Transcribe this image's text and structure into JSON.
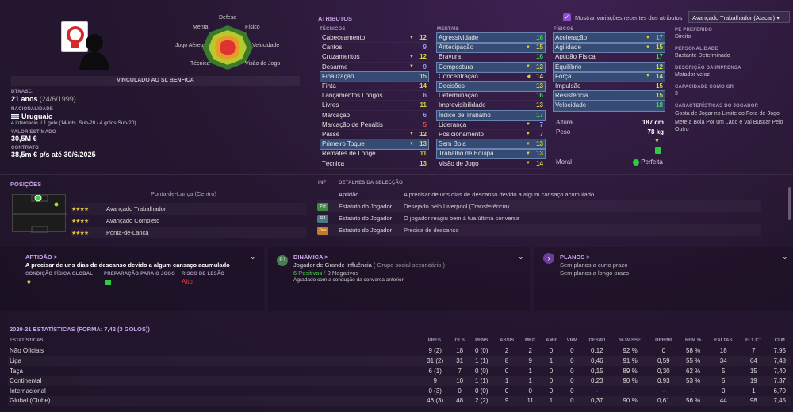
{
  "header": {
    "contract_banner": "VINCULADO AO SL BENFICA"
  },
  "position_radar": {
    "top": "Defesa",
    "top_right": "Físico",
    "right": "Velocidade",
    "bottom_right": "Visão de Jogo",
    "bottom_left": "Técnica",
    "left": "Jogo Aéreo",
    "top_left": "Mental"
  },
  "player": {
    "dob_label": "DTNASC.",
    "age": "21 anos",
    "dob": "(24/6/1999)",
    "nationality_label": "NACIONALIDADE",
    "nationality": "Uruguaio",
    "caps": "4 internacio. / 1 golo (14 ints. Sub-20 / 4 golos Sub-20)",
    "value_label": "VALOR ESTIMADO",
    "value": "30,5M €",
    "contract_label": "CONTRATO",
    "contract": "38,5m € p/s até 30/6/2025"
  },
  "attributes": {
    "title": "ATRIBUTOS",
    "show_changes_label": "Mostrar variações recentes dos atributos",
    "role_select": "Avançado Trabalhador (Atacar)",
    "technical_title": "TÉCNICOS",
    "mental_title": "MENTAIS",
    "physical_title": "FÍSICOS",
    "technical": [
      {
        "n": "Cabeceamento",
        "v": "12"
      },
      {
        "n": "Cantos",
        "v": "9"
      },
      {
        "n": "Cruzamentos",
        "v": "12"
      },
      {
        "n": "Desarme",
        "v": "9"
      },
      {
        "n": "Finalização",
        "v": "15"
      },
      {
        "n": "Finta",
        "v": "14"
      },
      {
        "n": "Lançamentos Longos",
        "v": "6"
      },
      {
        "n": "Livres",
        "v": "11"
      },
      {
        "n": "Marcação",
        "v": "6"
      },
      {
        "n": "Marcação de Penáltis",
        "v": "5"
      },
      {
        "n": "Passe",
        "v": "12"
      },
      {
        "n": "Primeiro Toque",
        "v": "13"
      },
      {
        "n": "Remates de Longe",
        "v": "11"
      },
      {
        "n": "Técnica",
        "v": "13"
      }
    ],
    "mental": [
      {
        "n": "Agressividade",
        "v": "16"
      },
      {
        "n": "Antecipação",
        "v": "15"
      },
      {
        "n": "Bravura",
        "v": "16"
      },
      {
        "n": "Compostura",
        "v": "13"
      },
      {
        "n": "Concentração",
        "v": "14"
      },
      {
        "n": "Decisões",
        "v": "13"
      },
      {
        "n": "Determinação",
        "v": "16"
      },
      {
        "n": "Imprevisibilidade",
        "v": "13"
      },
      {
        "n": "Índice de Trabalho",
        "v": "17"
      },
      {
        "n": "Liderança",
        "v": "7"
      },
      {
        "n": "Posicionamento",
        "v": "7"
      },
      {
        "n": "Sem Bola",
        "v": "13"
      },
      {
        "n": "Trabalho de Equipa",
        "v": "13"
      },
      {
        "n": "Visão de Jogo",
        "v": "14"
      }
    ],
    "physical": [
      {
        "n": "Aceleração",
        "v": "17"
      },
      {
        "n": "Agilidade",
        "v": "15"
      },
      {
        "n": "Aptidão Física",
        "v": "17"
      },
      {
        "n": "Equilíbrio",
        "v": "12"
      },
      {
        "n": "Força",
        "v": "14"
      },
      {
        "n": "Impulsão",
        "v": "15"
      },
      {
        "n": "Resistência",
        "v": "15"
      },
      {
        "n": "Velocidade",
        "v": "18"
      }
    ],
    "height_label": "Altura",
    "height": "187 cm",
    "weight_label": "Peso",
    "weight": "78 kg",
    "morale_label": "Moral",
    "morale": "Perfeita"
  },
  "right": {
    "foot_label": "PÉ PREFERIDO",
    "foot": "Direito",
    "personality_label": "PERSONALIDADE",
    "personality": "Bastante Determinado",
    "press_label": "DESCRIÇÃO DA IMPRENSA",
    "press": "Matador veloz",
    "gk_label": "CAPACIDADE COMO GR",
    "gk": "3",
    "traits_label": "CARACTERÍSTICAS DO JOGADOR",
    "trait1": "Gosta de Jogar no Limite do Fora-de-Jogo",
    "trait2": "Mete a Bola Por um Lado e Vai Buscar Pelo Outro"
  },
  "positions": {
    "title": "POSIÇÕES",
    "main": "Ponta-de-Lança (Centro)",
    "roles": [
      {
        "stars": "★★★★",
        "name": "Avançado Trabalhador"
      },
      {
        "stars": "★★★★",
        "name": "Avançado Completo"
      },
      {
        "stars": "★★★★",
        "name": "Ponta-de-Lança"
      }
    ]
  },
  "info": {
    "inf_label": "INF",
    "details_label": "DETALHES DA SELECÇÃO",
    "rows": [
      {
        "badge": "",
        "name": "Aptidão",
        "desc": "A precisar de uns dias de descanso devido a algum cansaço acumulado"
      },
      {
        "badge": "Pvf",
        "name": "Estatuto do Jogador",
        "desc": "Desejado pelo Liverpool (Transferência)"
      },
      {
        "badge": "RJ",
        "name": "Estatuto do Jogador",
        "desc": "O jogador reagiu bem à tua última conversa"
      },
      {
        "badge": "Des",
        "name": "Estatuto do Jogador",
        "desc": "Precisa de descanso"
      }
    ]
  },
  "cards": {
    "fitness": {
      "title": "APTIDÃO >",
      "text": "A precisar de uns dias de descanso devido a algum cansaço acumulado",
      "c1": "CONDIÇÃO FÍSICA GLOBAL",
      "c2": "PREPARAÇÃO PARA O JOGO",
      "c3": "RISCO DE LESÃO",
      "risk": "Alto"
    },
    "dynamics": {
      "title": "DINÂMICA >",
      "text": "Jogador de Grande Influência",
      "group": "( Grupo social secundário )",
      "pos": "6 Positivos",
      "neg": "0 Negativos",
      "note": "Agradado com a condução da conversa anterior"
    },
    "plans": {
      "title": "PLANOS >",
      "short": "Sem planos a curto prazo",
      "long": "Sem planos a longo prazo"
    }
  },
  "stats": {
    "title": "2020-21 ESTATÍSTICAS (FORMA: 7,42 (3 GOLOS))",
    "headers": [
      "ESTATÍSTICAS",
      "PRES.",
      "GLS",
      "PENS",
      "ASSIS",
      "MEC",
      "AMR",
      "VRM",
      "DES/90",
      "% PASSE",
      "DRB/90",
      "REM %",
      "FALTAS",
      "FLT CT",
      "CLM"
    ],
    "rows": [
      [
        "Não Oficiais",
        "9 (2)",
        "18",
        "0 (0)",
        "2",
        "2",
        "0",
        "0",
        "0,12",
        "92 %",
        "0",
        "58 %",
        "18",
        "7",
        "7,95"
      ],
      [
        "Liga",
        "31 (2)",
        "31",
        "1 (1)",
        "8",
        "9",
        "1",
        "0",
        "0,46",
        "91 %",
        "0,59",
        "55 %",
        "34",
        "64",
        "7,48"
      ],
      [
        "Taça",
        "6 (1)",
        "7",
        "0 (0)",
        "0",
        "1",
        "0",
        "0",
        "0,15",
        "89 %",
        "0,30",
        "62 %",
        "5",
        "15",
        "7,40"
      ],
      [
        "Continental",
        "9",
        "10",
        "1 (1)",
        "1",
        "1",
        "0",
        "0",
        "0,23",
        "90 %",
        "0,93",
        "53 %",
        "5",
        "19",
        "7,37"
      ],
      [
        "Internacional",
        "0 (3)",
        "0",
        "0 (0)",
        "0",
        "0",
        "0",
        "0",
        "-",
        "-",
        "-",
        "-",
        "0",
        "1",
        "6,70"
      ],
      [
        "Global (Clube)",
        "46 (3)",
        "48",
        "2 (2)",
        "9",
        "11",
        "1",
        "0",
        "0,37",
        "90 %",
        "0,61",
        "56 %",
        "44",
        "98",
        "7,45"
      ]
    ]
  }
}
